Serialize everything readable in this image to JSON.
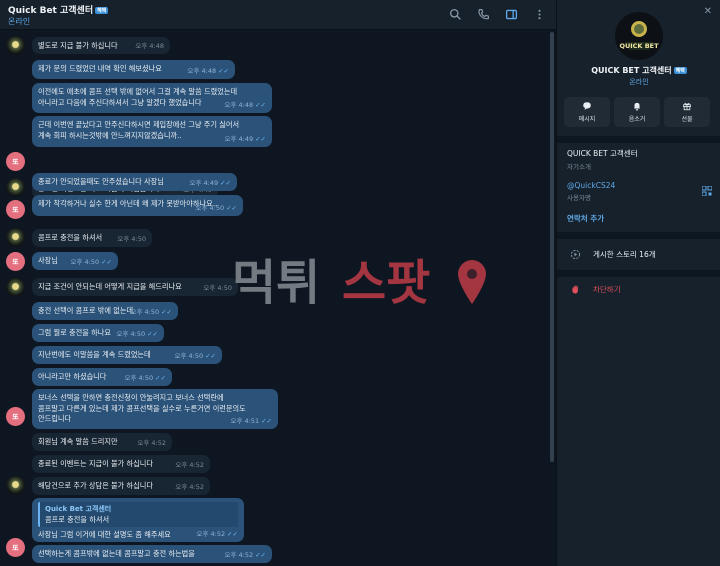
{
  "header": {
    "title": "Quick Bet 고객센터",
    "verified_badge": "혜택",
    "status": "온라인",
    "icons": [
      "search-icon",
      "phone-icon",
      "sidebar-toggle-icon",
      "more-vertical-icon"
    ]
  },
  "messages": [
    {
      "kind": "in",
      "text": "별도로 지급 불가 하십니다",
      "time": "오후 4:48"
    },
    {
      "kind": "out",
      "text": "제가 문의 드렸었던 내역 확인 해보셨나요",
      "time": "오후 4:48"
    },
    {
      "kind": "out",
      "text": "이전에도 애초에 콤프 선택 밖에 없어서 그걸 계속 말씀 드렸었는데\n아니라고 다음에 주신다하셔서 그냥 알겠다 했었습니다",
      "time": "오후 4:48"
    },
    {
      "kind": "out",
      "text": "근데 이번엔 끝났다고 안주신다하시면 제입장에선 그냥 주기 싫어서\n계속 회피 하시는것밖에 안느껴지지않겠습니까..",
      "time": "오후 4:49"
    },
    {
      "kind": "in",
      "text": "종료된 이벤트는 따로 지급이 어렵습니다",
      "time": "오후 4:49"
    },
    {
      "kind": "out",
      "text": "종료가 안되었을때도 안주셨습니다 사장님",
      "time": "오후 4:49"
    },
    {
      "kind": "out",
      "text": "제가 착각하거나 실수 한게 아닌데 왜 제가 못받아야하나요..",
      "time": "오후 4:50"
    },
    {
      "kind": "in",
      "text": "콤프로 충전을 하셔서",
      "time": "오후 4:50"
    },
    {
      "kind": "out",
      "text": "사장님",
      "time": "오후 4:50"
    },
    {
      "kind": "in",
      "text": "지급 조건이 안되는데 어떻게 지급을 해드리나요",
      "time": "오후 4:50"
    },
    {
      "kind": "out",
      "text": "충전 선택이 콤프로 밖에 없는데",
      "time": "오후 4:50"
    },
    {
      "kind": "out",
      "text": "그럼 뭘로 충전을 하나요",
      "time": "오후 4:50"
    },
    {
      "kind": "out",
      "text": "지난번에도 이말씀을 계속 드렸었는데",
      "time": "오후 4:50"
    },
    {
      "kind": "out",
      "text": "아니라고만 하셨습니다",
      "time": "오후 4:50"
    },
    {
      "kind": "out",
      "text": "보너스 선택을 안하면 충전신청이 안눌려지고 보너스 선택란에\n콤프말고 다른게 있는데 제가 콤프선택을 실수로 누른거면 이런문의도\n안드립니다",
      "time": "오후 4:51"
    },
    {
      "kind": "in",
      "text": "회원님 계속 말씀 드리지만",
      "time": "오후 4:52"
    },
    {
      "kind": "in",
      "text": "종료된 이벤트는 지급이 불가 하십니다",
      "time": "오후 4:52"
    },
    {
      "kind": "in",
      "text": "해당건으로 추가 상담은 불가 하십니다",
      "time": "오후 4:52"
    },
    {
      "kind": "out",
      "reply_name": "Quick Bet 고객센터",
      "reply_text": "콤프로 충전을 하셔서",
      "text": "사장님 그럼 이거에 대한 설명도 좀 해주세요",
      "time": "오후 4:52"
    },
    {
      "kind": "out",
      "text": "선택하는게 콤프밖에 없는데 콤프말고 충전 하는법을",
      "time": "오후 4:52"
    }
  ],
  "panel": {
    "name": "QUICK BET 고객센터",
    "verified_badge": "혜택",
    "status": "온라인",
    "logo_text": "QUICK BET",
    "actions": [
      {
        "icon": "message-icon",
        "label": "메시지"
      },
      {
        "icon": "bell-icon",
        "label": "음소거"
      },
      {
        "icon": "gift-icon",
        "label": "선물"
      }
    ],
    "bio_title": "QUICK BET 고객센터",
    "bio_label": "자기소개",
    "username": "@QuickCS24",
    "username_label": "사용자명",
    "add_contact": "연락처 추가",
    "stories": "게시한 스토리 16개",
    "block": "차단하기"
  },
  "watermark": {
    "text_left": "먹튀",
    "text_right": "스팟"
  },
  "colors": {
    "bg": "#0e1621",
    "panel": "#17212b",
    "outgoing": "#2b5278",
    "incoming": "#182533",
    "accent": "#5fa9e8",
    "danger": "#e0505a"
  }
}
